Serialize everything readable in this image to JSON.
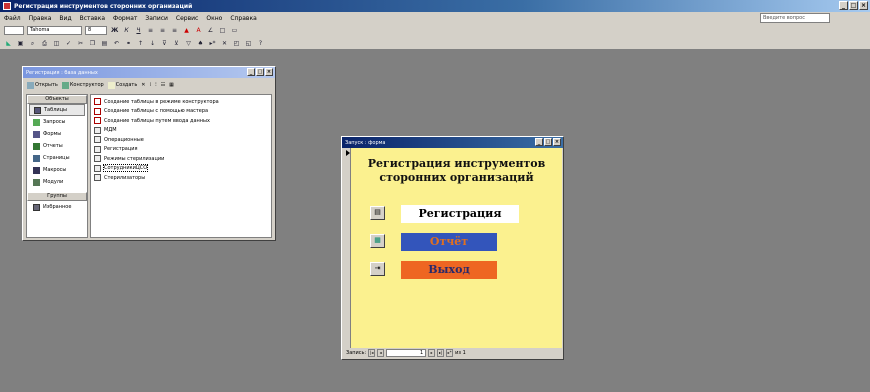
{
  "app": {
    "title": "Регистрация инструментов сторонних организаций"
  },
  "menu": {
    "items": [
      "Файл",
      "Правка",
      "Вид",
      "Вставка",
      "Формат",
      "Записи",
      "Сервис",
      "Окно",
      "Справка"
    ],
    "help_box": "Введите вопрос"
  },
  "toolbar": {
    "font_name": "Tahoma",
    "font_size": "8"
  },
  "db_window": {
    "title": "Регистрация : база данных",
    "open_label": "Открыть",
    "design_label": "Конструктор",
    "create_label": "Создать",
    "objects_header": "Объекты",
    "objects": [
      "Таблицы",
      "Запросы",
      "Формы",
      "Отчеты",
      "Страницы",
      "Макросы",
      "Модули"
    ],
    "groups_header": "Группы",
    "favorites": "Избранное",
    "items": [
      "Создание таблицы в режиме конструктора",
      "Создание таблицы с помощью мастера",
      "Создание таблицы путем ввода данных",
      "МДМ",
      "Операционные",
      "Регистрация",
      "Режимы стерилизации",
      "СотрудникиЦСО",
      "Стерилизаторы"
    ]
  },
  "form_window": {
    "title": "Запуск : форма",
    "heading_line1": "Регистрация инструментов",
    "heading_line2": "сторонних организаций",
    "btn_register": "Регистрация",
    "btn_report": "Отчёт",
    "btn_exit": "Выход",
    "nav_label": "Запись:",
    "nav_current": "1",
    "nav_total": "из 1",
    "colors": {
      "form_bg": "#fbf18f",
      "report_bg": "#3355bb",
      "exit_bg": "#ee6622"
    }
  }
}
